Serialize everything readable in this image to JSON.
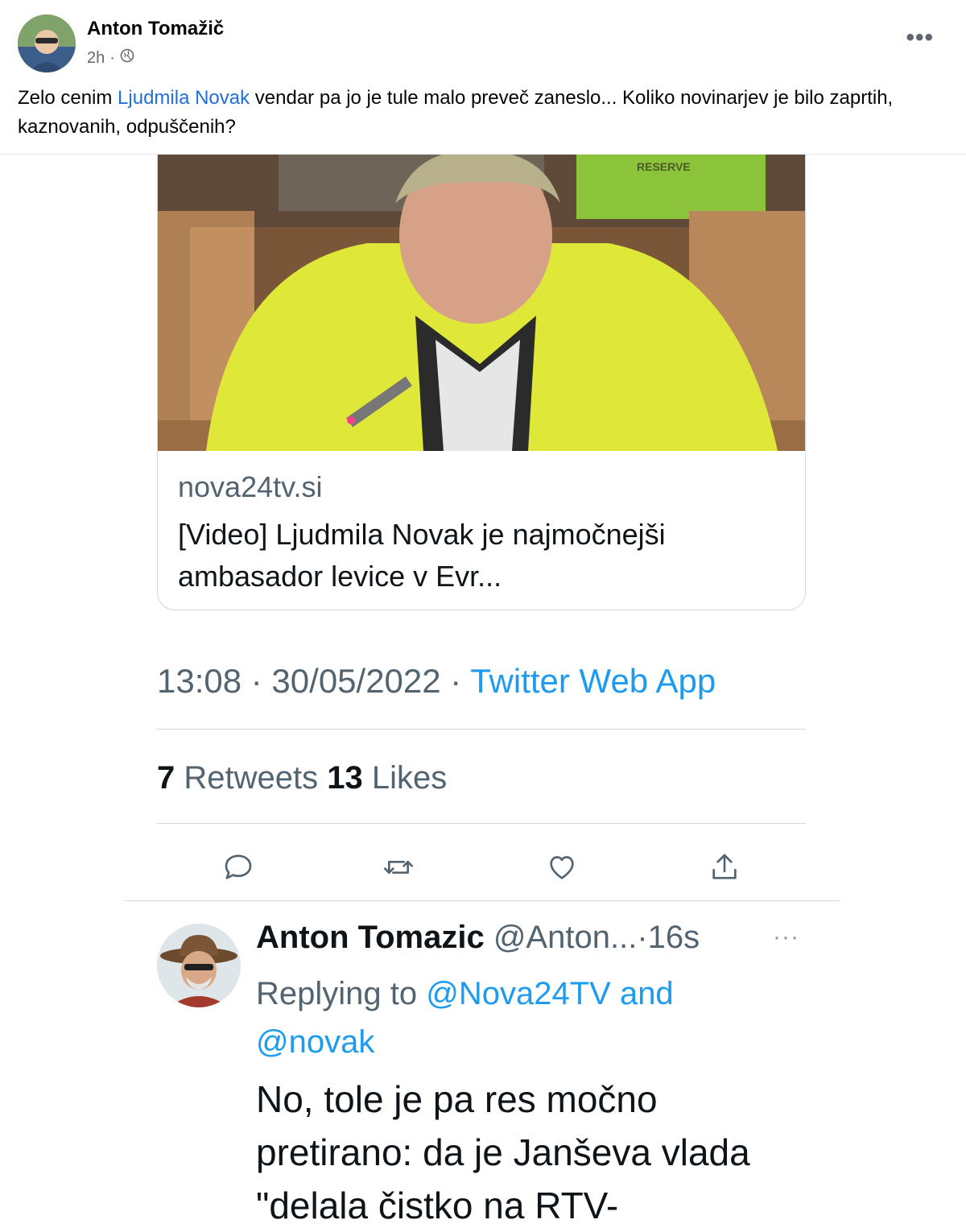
{
  "post": {
    "author": "Anton Tomažič",
    "time": "2h",
    "separator": "·",
    "privacy_icon": "globe-icon",
    "more_icon": "more-horizontal-icon",
    "text_before": "Zelo cenim ",
    "mention": "Ljudmila Novak",
    "text_after": " vendar pa jo je tule malo preveč zaneslo... Koliko novinarjev je bilo zaprtih, kaznovanih, odpuščenih?"
  },
  "tweet": {
    "card": {
      "image_badge": "RESERVE",
      "domain": "nova24tv.si",
      "title": "[Video] Ljudmila Novak je najmočnejši ambasador levice v Evr..."
    },
    "time": "13:08 · 30/05/2022 · ",
    "app": "Twitter Web App",
    "retweets_count": "7",
    "retweets_label": "Retweets",
    "likes_count": "13",
    "likes_label": "Likes",
    "actions": [
      "reply-icon",
      "retweet-icon",
      "like-icon",
      "share-icon"
    ]
  },
  "reply": {
    "name": "Anton Tomazic",
    "handle": "@Anton...",
    "age": "·16s",
    "more": "···",
    "replying_prefix": "Replying to ",
    "handle1": "@Nova24TV",
    "connector": " and",
    "handle2": "@novak",
    "text": "No, tole je pa res močno pretirano: da je Janševa vlada \"delala čistko na RTV-"
  },
  "colors": {
    "facebook_link": "#216fdb",
    "twitter_blue": "#1d9bf0",
    "secondary_text": "#536471",
    "jacket": "#dfe838"
  }
}
